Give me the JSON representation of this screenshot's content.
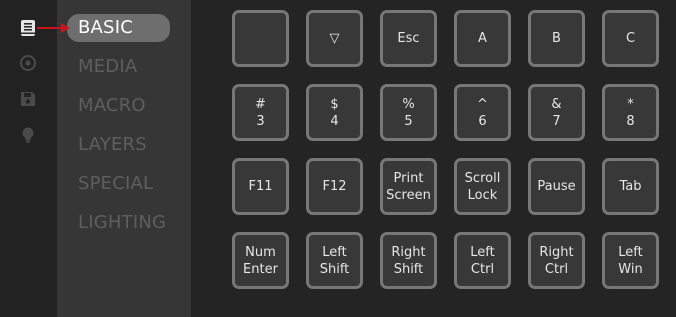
{
  "rail": {
    "icons": [
      "book-icon",
      "disc-icon",
      "save-icon",
      "lightbulb-icon"
    ]
  },
  "categories": [
    "BASIC",
    "MEDIA",
    "MACRO",
    "LAYERS",
    "SPECIAL",
    "LIGHTING"
  ],
  "active_category": "BASIC",
  "keys": [
    [
      "",
      "▽",
      "Esc",
      "A",
      "B",
      "C"
    ],
    [
      "#\n3",
      "$\n4",
      "%\n5",
      "^\n6",
      "&\n7",
      "*\n8"
    ],
    [
      "F11",
      "F12",
      "Print\nScreen",
      "Scroll\nLock",
      "Pause",
      "Tab"
    ],
    [
      "Num\nEnter",
      "Left\nShift",
      "Right\nShift",
      "Left Ctrl",
      "Right\nCtrl",
      "Left\nWin"
    ]
  ],
  "colors": {
    "accent_arrow": "#c8151b",
    "key_border": "#777777",
    "key_fill": "#383838",
    "active_category_bg": "#6e6e6e"
  }
}
